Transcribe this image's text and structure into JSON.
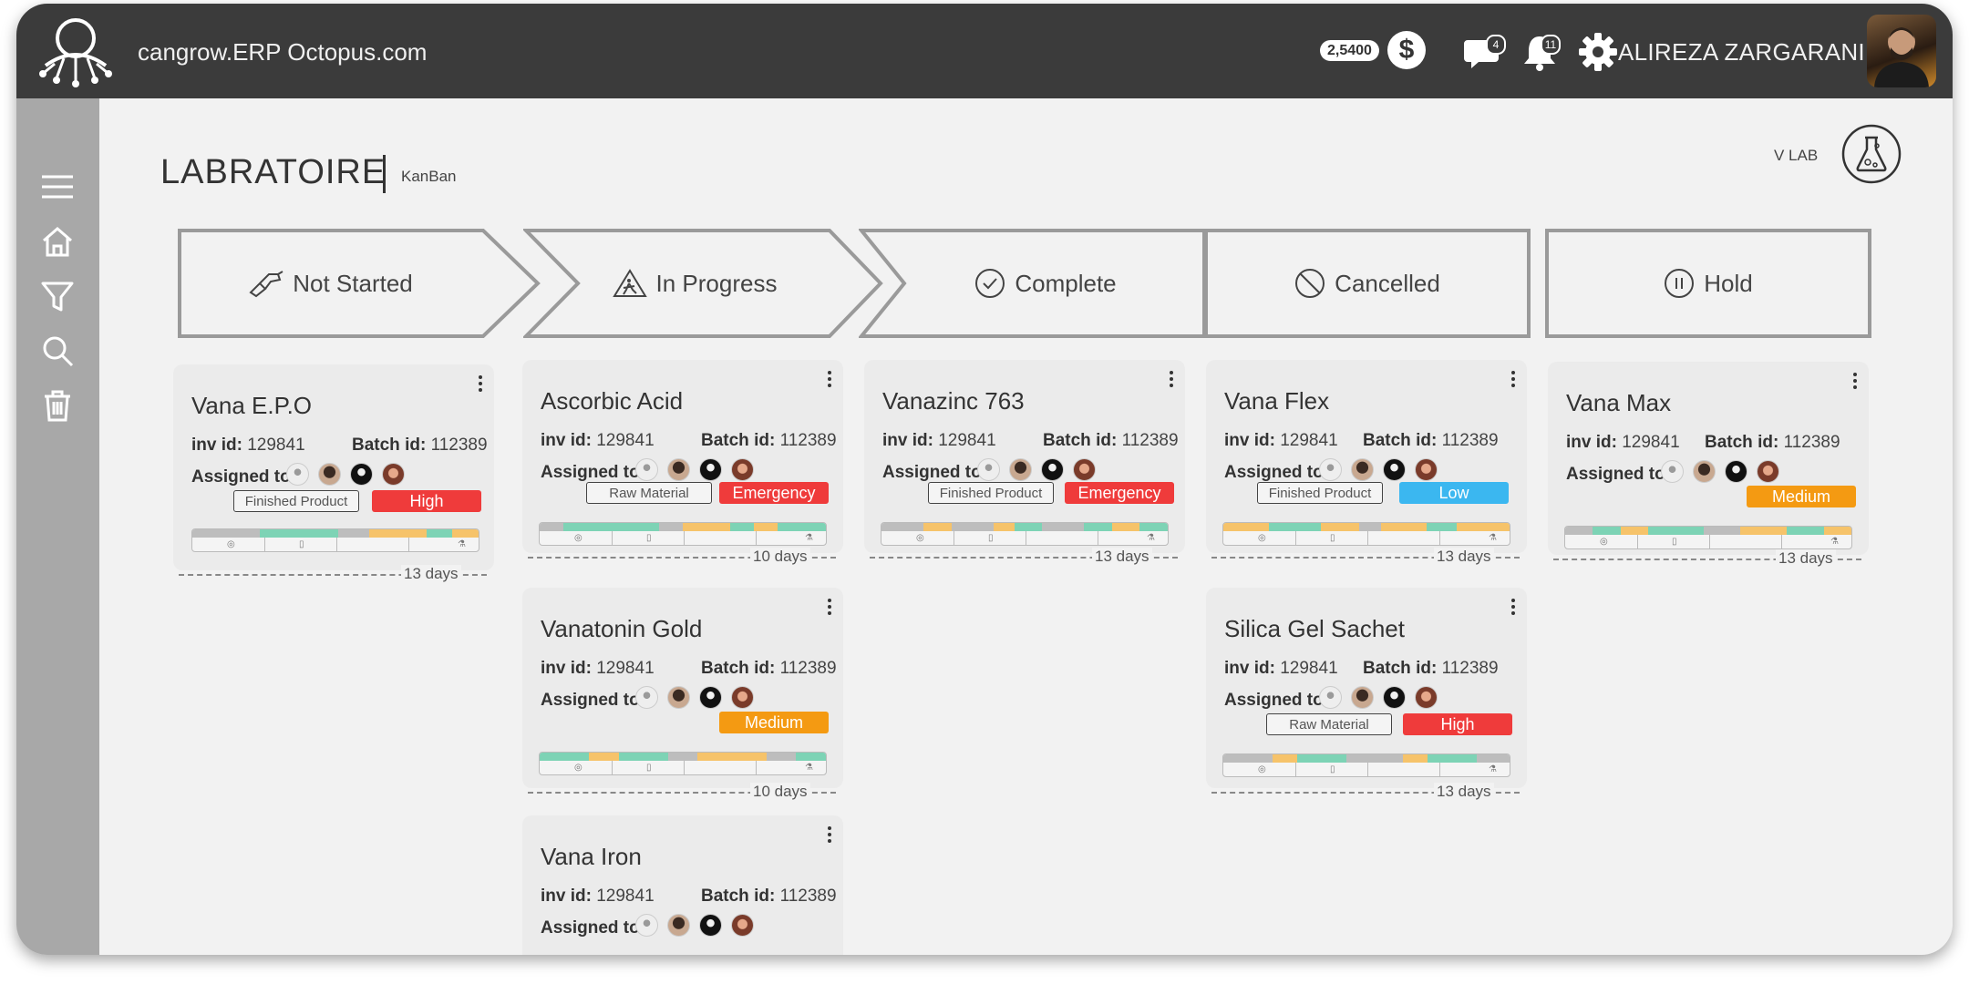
{
  "header": {
    "app_title": "cangrow.ERP Octopus.com",
    "balance": "2,5400",
    "currency_icon": "dollar-icon",
    "messages_count": "4",
    "notifications_count": "11",
    "user_name": "ALIREZA ZARGARANI"
  },
  "sidebar": {
    "items": [
      "menu-icon",
      "home-icon",
      "filter-icon",
      "search-icon",
      "trash-icon"
    ]
  },
  "page": {
    "title": "LABRATOIRE",
    "subtitle": "KanBan",
    "lab_label": "V LAB"
  },
  "colors": {
    "topbar": "#3b3b3b",
    "sidebar": "#a8a8a8",
    "high": "#ef3b3b",
    "emergency": "#ef3b3b",
    "medium": "#f49a12",
    "low": "#3bb7f0",
    "seg_green": "#7dd3b5",
    "seg_orange": "#f6c36a",
    "seg_gray": "#bdbdbd"
  },
  "columns": [
    {
      "label": "Not Started",
      "icon": "drill-icon"
    },
    {
      "label": "In Progress",
      "icon": "construction-icon"
    },
    {
      "label": "Complete",
      "icon": "check-circle-icon"
    },
    {
      "label": "Cancelled",
      "icon": "cancel-icon"
    },
    {
      "label": "Hold",
      "icon": "pause-icon"
    }
  ],
  "card_labels": {
    "inv_prefix": "inv id:",
    "batch_prefix": "Batch id:",
    "assigned": "Assigned to:"
  },
  "cards": {
    "vana_epo": {
      "name": "Vana E.P.O",
      "inv": "129841",
      "batch": "112389",
      "type": "Finished Product",
      "priority": "High",
      "days": "13 days"
    },
    "ascorbic_acid": {
      "name": "Ascorbic Acid",
      "inv": "129841",
      "batch": "112389",
      "type": "Raw Material",
      "priority": "Emergency",
      "days": "10 days"
    },
    "vanatonin_gold": {
      "name": "Vanatonin Gold",
      "inv": "129841",
      "batch": "112389",
      "priority": "Medium",
      "days": "10 days"
    },
    "vana_iron": {
      "name": "Vana Iron",
      "inv": "129841",
      "batch": "112389"
    },
    "vanazinc_763": {
      "name": "Vanazinc 763",
      "inv": "129841",
      "batch": "112389",
      "type": "Finished Product",
      "priority": "Emergency",
      "days": "13 days"
    },
    "vana_flex": {
      "name": "Vana Flex",
      "inv": "129841",
      "batch": "112389",
      "type": "Finished Product",
      "priority": "Low",
      "days": "13 days"
    },
    "silica_gel": {
      "name": "Silica Gel Sachet",
      "inv": "129841",
      "batch": "112389",
      "type": "Raw Material",
      "priority": "High",
      "days": "13 days"
    },
    "vana_max": {
      "name": "Vana Max",
      "inv": "129841",
      "batch": "112389",
      "priority": "Medium",
      "days": "13 days"
    }
  }
}
